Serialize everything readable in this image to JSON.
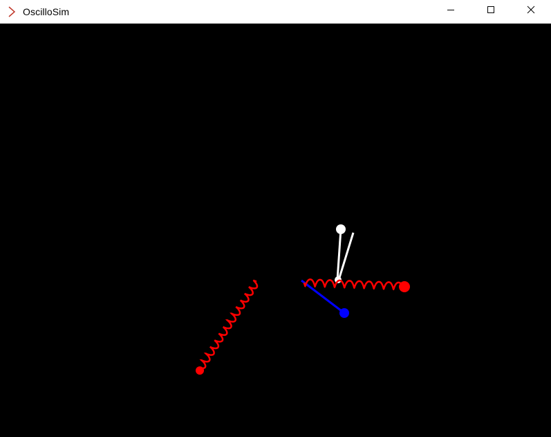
{
  "window": {
    "title": "OscilloSim",
    "app_icon": "chevron-right-icon",
    "minimize_icon": "minimize-icon",
    "maximize_icon": "maximize-icon",
    "close_icon": "close-icon"
  },
  "colors": {
    "background": "#000000",
    "titlebar": "#ffffff",
    "spring": "#ff0000",
    "pendulum": "#ffffff",
    "rod": "#0000ff",
    "app_icon": "#c0392b"
  }
}
